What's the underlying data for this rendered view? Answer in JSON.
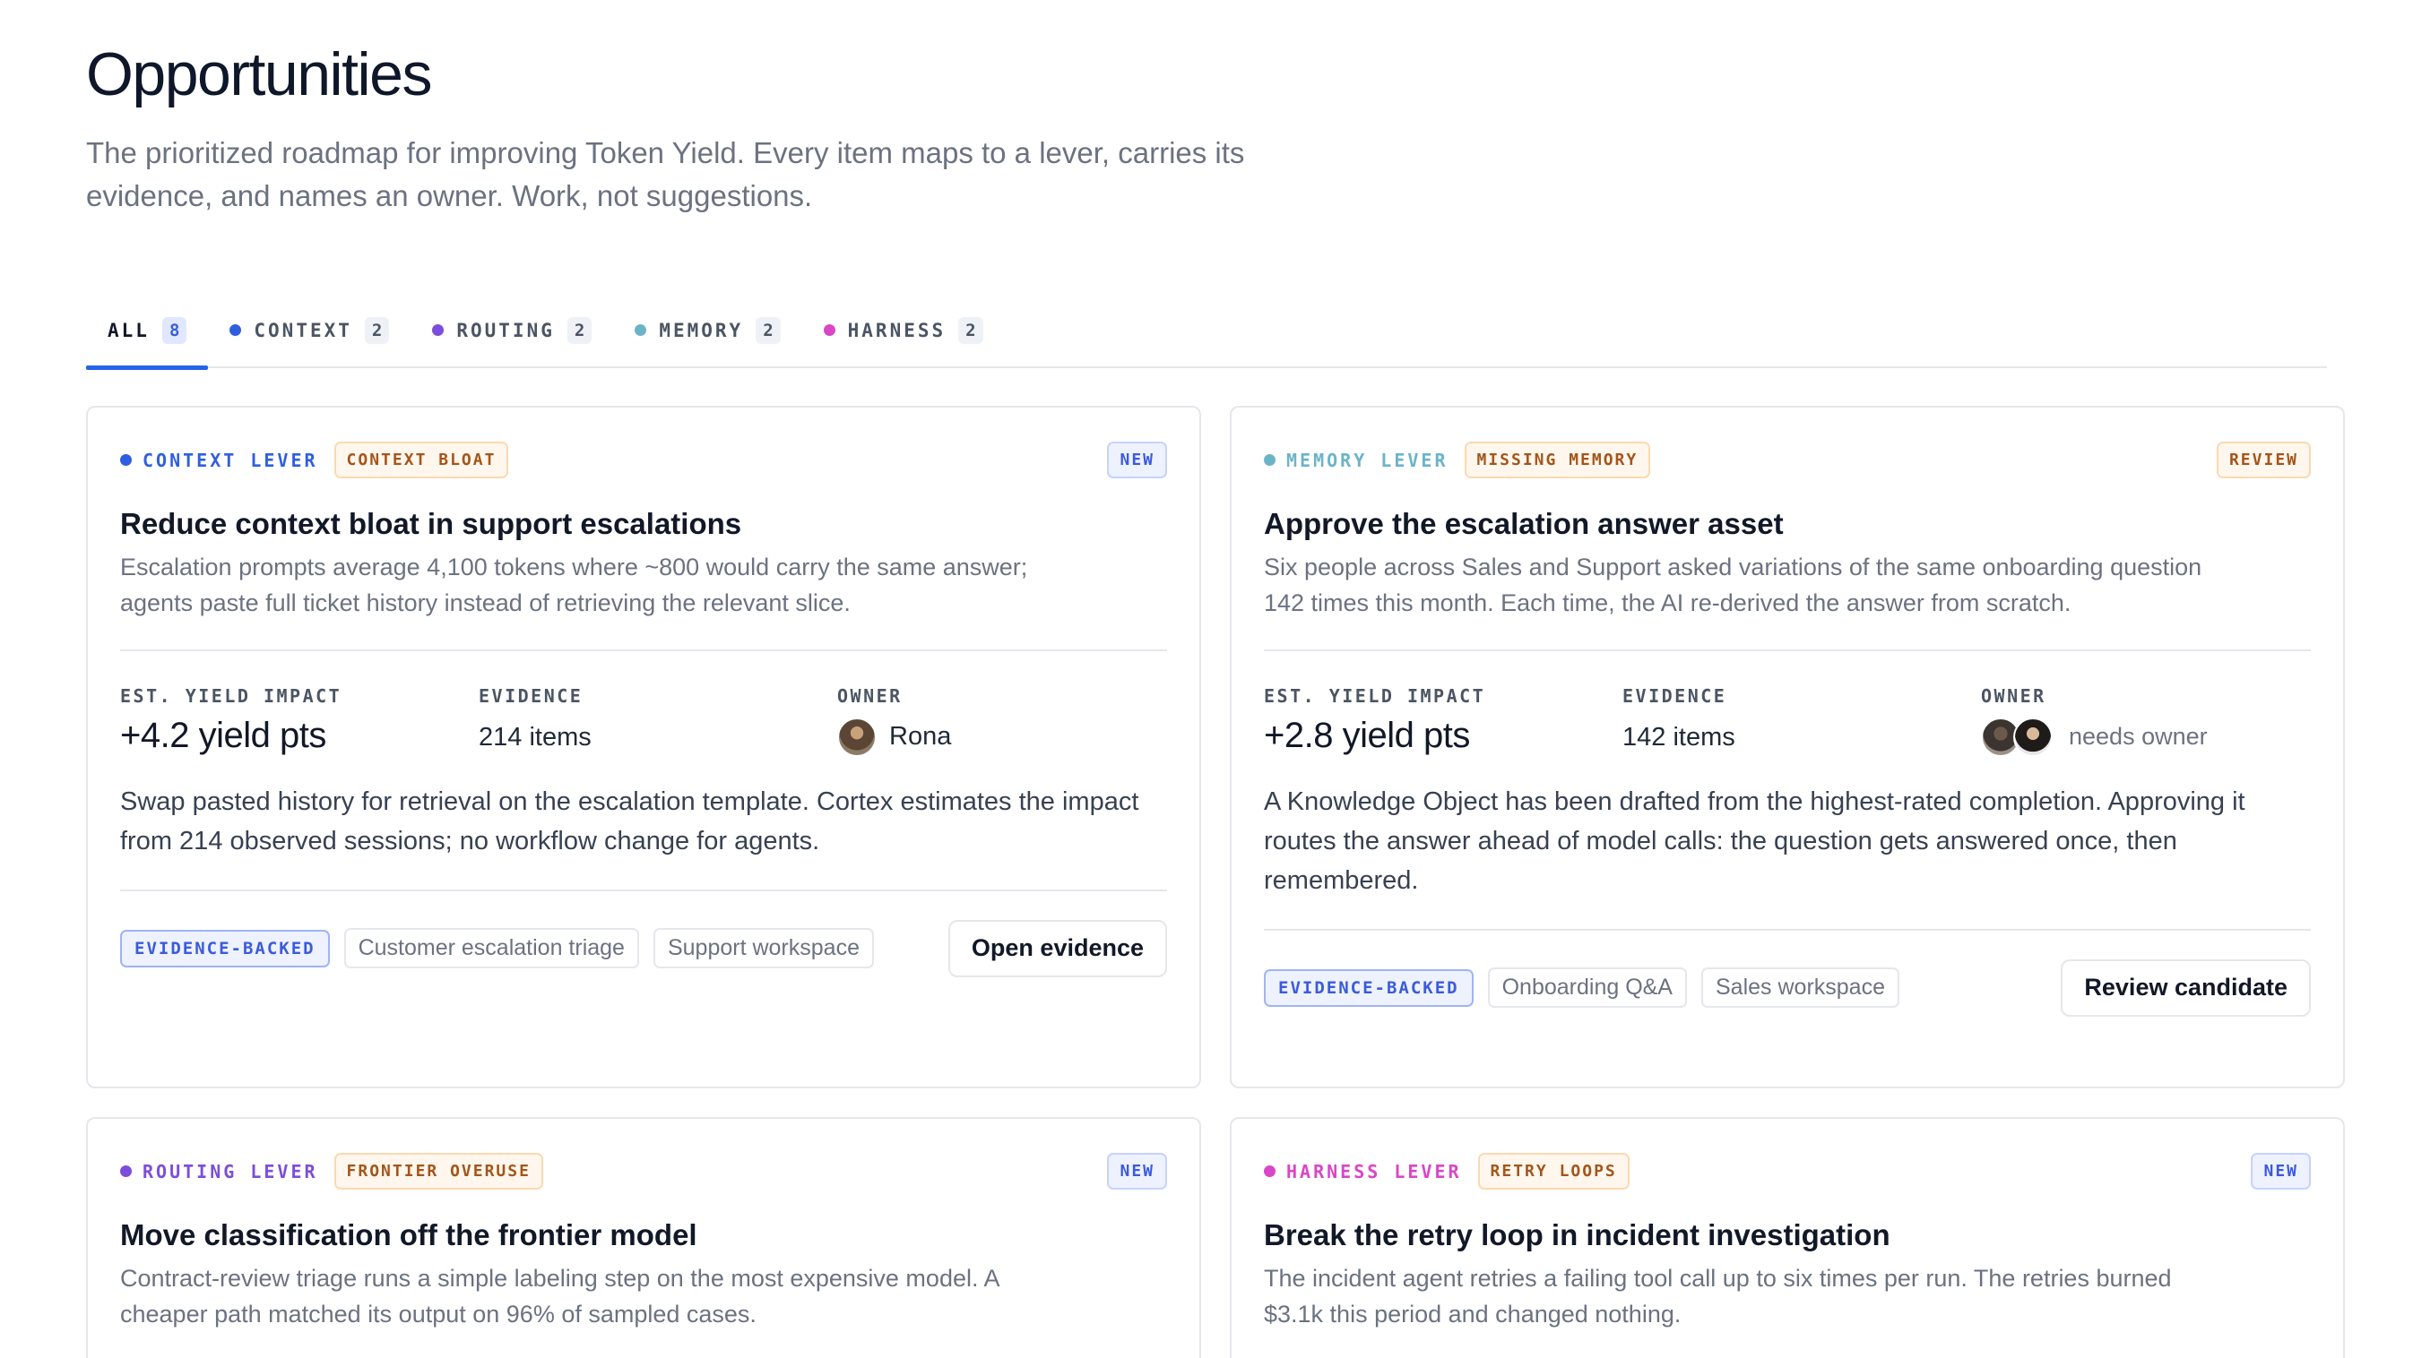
{
  "page": {
    "title": "Opportunities",
    "subtitle": "The prioritized roadmap for improving Token Yield. Every item maps to a lever, carries its evidence, and names an owner. Work, not suggestions."
  },
  "tabs": [
    {
      "label": "ALL",
      "count": "8",
      "active": true
    },
    {
      "label": "CONTEXT",
      "count": "2",
      "color": "#2f5fe0"
    },
    {
      "label": "ROUTING",
      "count": "2",
      "color": "#7c4ddb"
    },
    {
      "label": "MEMORY",
      "count": "2",
      "color": "#6bb4c8"
    },
    {
      "label": "HARNESS",
      "count": "2",
      "color": "#d946c8"
    }
  ],
  "labels": {
    "yield_impact": "EST. YIELD IMPACT",
    "evidence": "EVIDENCE",
    "owner": "OWNER",
    "evidence_backed": "EVIDENCE-BACKED"
  },
  "cards": [
    {
      "lever": "CONTEXT LEVER",
      "lever_color": "#2f5fe0",
      "issue": "CONTEXT BLOAT",
      "status": "NEW",
      "title": "Reduce context bloat in support escalations",
      "description": "Escalation prompts average 4,100 tokens where ~800 would carry the same answer; agents paste full ticket history instead of retrieving the relevant slice.",
      "yield": "+4.2 yield pts",
      "evidence": "214 items",
      "owner": "Rona",
      "body": "Swap pasted history for retrieval on the escalation template. Cortex estimates the impact from 214 observed sessions; no workflow change for agents.",
      "chips": [
        "Customer escalation triage",
        "Support workspace"
      ],
      "action": "Open evidence"
    },
    {
      "lever": "MEMORY LEVER",
      "lever_color": "#6bb4c8",
      "issue": "MISSING MEMORY",
      "status": "REVIEW",
      "title": "Approve the escalation answer asset",
      "description": "Six people across Sales and Support asked variations of the same onboarding question 142 times this month. Each time, the AI re-derived the answer from scratch.",
      "yield": "+2.8 yield pts",
      "evidence": "142 items",
      "owner": "needs owner",
      "body": "A Knowledge Object has been drafted from the highest-rated completion. Approving it routes the answer ahead of model calls: the question gets answered once, then remembered.",
      "chips": [
        "Onboarding Q&A",
        "Sales workspace"
      ],
      "action": "Review candidate"
    },
    {
      "lever": "ROUTING LEVER",
      "lever_color": "#7c4ddb",
      "issue": "FRONTIER OVERUSE",
      "status": "NEW",
      "title": "Move classification off the frontier model",
      "description": "Contract-review triage runs a simple labeling step on the most expensive model. A cheaper path matched its output on 96% of sampled cases."
    },
    {
      "lever": "HARNESS LEVER",
      "lever_color": "#d946c8",
      "issue": "RETRY LOOPS",
      "status": "NEW",
      "title": "Break the retry loop in incident investigation",
      "description": "The incident agent retries a failing tool call up to six times per run. The retries burned $3.1k this period and changed nothing."
    }
  ]
}
